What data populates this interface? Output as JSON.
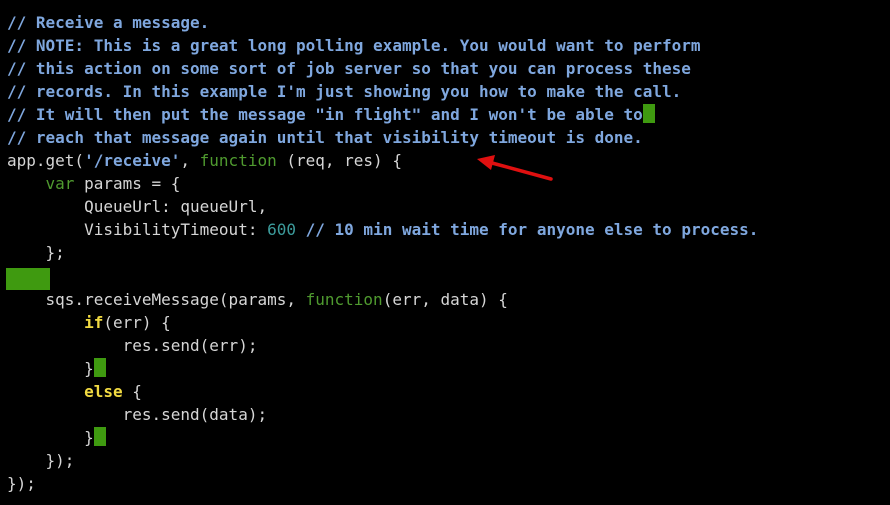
{
  "code": {
    "comment_lines": [
      "// Receive a message.",
      "// NOTE: This is a great long polling example. You would want to perform",
      "// this action on some sort of job server so that you can process these",
      "// records. In this example I'm just showing you how to make the call.",
      "// It will then put the message \"in flight\" and I won't be able to",
      "// reach that message again until that visibility timeout is done."
    ],
    "route": {
      "prefix": "app.get(",
      "path": "'/receive'",
      "sep": ", ",
      "keyword": "function",
      "suffix": " (req, res) {"
    },
    "params_line": {
      "indent": "    ",
      "keyword": "var",
      "rest": " params = {"
    },
    "queue_line": "        QueueUrl: queueUrl,",
    "timeout_line": {
      "prefix": "        VisibilityTimeout: ",
      "value": "600",
      "comment": " // 10 min wait time for anyone else to process."
    },
    "close_obj": "    };",
    "receive_line": {
      "prefix": "    sqs.receiveMessage(params, ",
      "keyword": "function",
      "suffix": "(err, data) {"
    },
    "if_line": {
      "indent": "        ",
      "keyword": "if",
      "rest": "(err) {"
    },
    "send_err": "            res.send(err);",
    "close_if": "        }",
    "else_line": {
      "indent": "        ",
      "keyword": "else",
      "rest": " {"
    },
    "send_data": "            res.send(data);",
    "close_else": "        }",
    "close_cb": "    });",
    "close_route": "});"
  },
  "colors": {
    "comment": "#7fa7de",
    "keyword": "#4f9a2f",
    "control_keyword": "#f1da42",
    "number": "#3c9b9b",
    "cursor": "#3f9a10",
    "arrow": "#e01010"
  }
}
